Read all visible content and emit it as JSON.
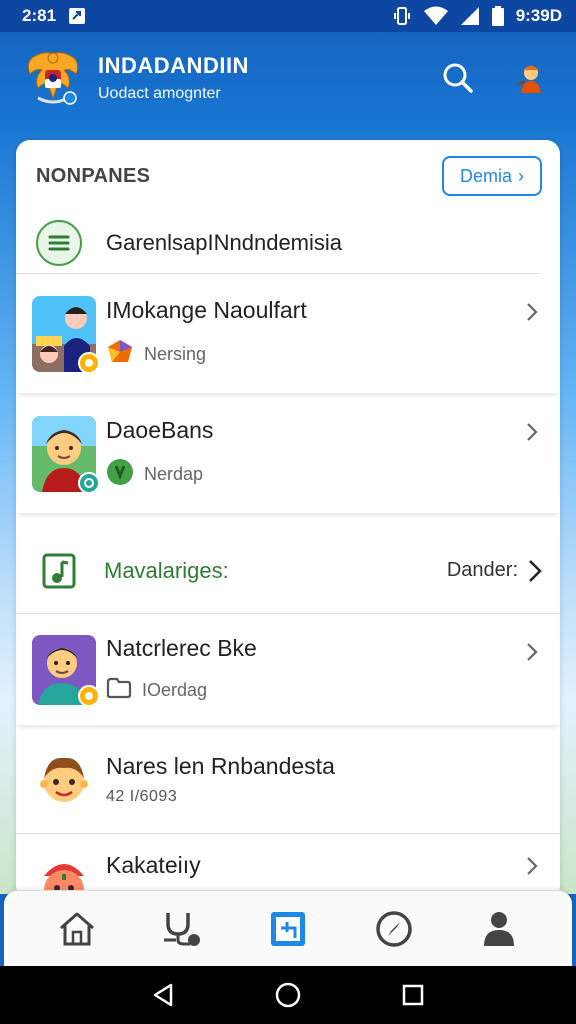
{
  "status_bar": {
    "time": "2:81",
    "clock": "9:39D"
  },
  "app_bar": {
    "title": "INDADANDIIN",
    "subtitle": "Uodact amognter"
  },
  "section": {
    "title": "NONPANES",
    "button_label": "Demia",
    "button_chevron": "›"
  },
  "feature": {
    "label": "GarenlsapINndndemisia"
  },
  "items": [
    {
      "title": "IMokange Naoulfart",
      "sub": "Nersing"
    },
    {
      "title": "DaoeBans",
      "sub": "Nerdap"
    }
  ],
  "music": {
    "label": "Mavalariges:",
    "action": "Dander:"
  },
  "items2": [
    {
      "title": "Natcrlerec Bke",
      "sub": "IOerdag"
    }
  ],
  "plain_items": [
    {
      "title": "Nares len Rnbandesta",
      "meta": "42 I/6093"
    },
    {
      "title": "Kakateiıy"
    }
  ],
  "colors": {
    "primary": "#1565c0",
    "accent": "#1e88e5",
    "green": "#2e7d32"
  }
}
